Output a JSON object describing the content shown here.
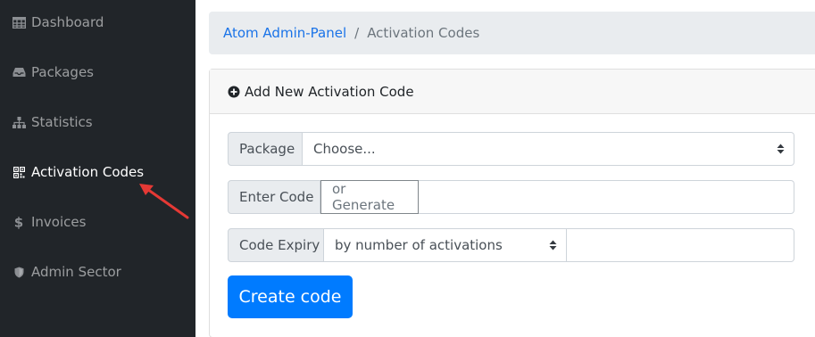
{
  "sidebar": {
    "items": [
      {
        "label": "Dashboard",
        "icon": "table-icon"
      },
      {
        "label": "Packages",
        "icon": "inbox-icon"
      },
      {
        "label": "Statistics",
        "icon": "sitemap-icon"
      },
      {
        "label": "Activation Codes",
        "icon": "qrcode-icon"
      },
      {
        "label": "Invoices",
        "icon": "dollar-icon"
      },
      {
        "label": "Admin Sector",
        "icon": "shield-icon"
      }
    ]
  },
  "breadcrumb": {
    "home": "Atom Admin-Panel",
    "separator": "/",
    "current": "Activation Codes"
  },
  "card": {
    "header": "Add New Activation Code",
    "package": {
      "label": "Package",
      "value": "Choose..."
    },
    "code": {
      "label": "Enter Code",
      "placeholder": "or Generate"
    },
    "expiry": {
      "label": "Code Expiry",
      "value": "by number of activations"
    },
    "submit": "Create code"
  },
  "colors": {
    "sidebar_bg": "#212529",
    "primary": "#007bff",
    "link": "#1a73e8",
    "annotation": "#e53935"
  }
}
